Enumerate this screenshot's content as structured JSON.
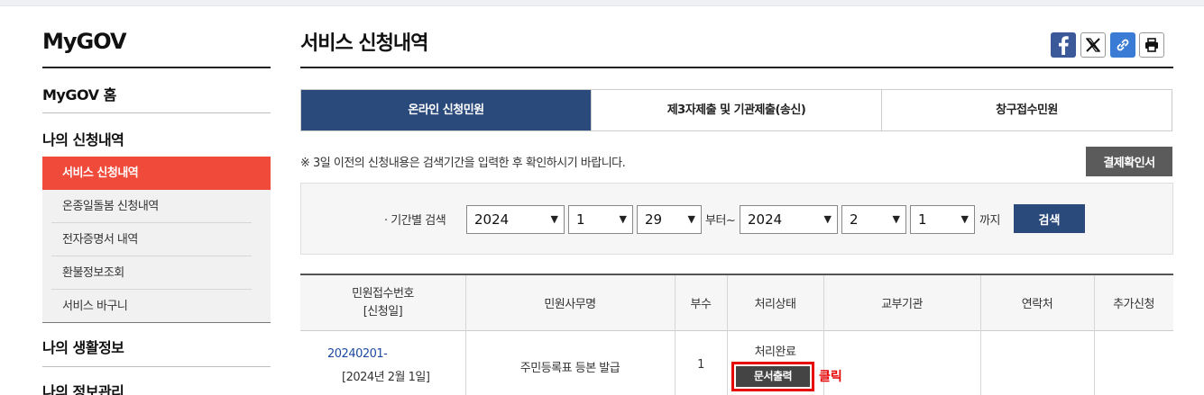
{
  "sidebar": {
    "brand": "MyGOV",
    "home": "MyGOV 홈",
    "section1": "나의 신청내역",
    "items": [
      {
        "label": "서비스 신청내역"
      },
      {
        "label": "온종일돌봄 신청내역"
      },
      {
        "label": "전자증명서 내역"
      },
      {
        "label": "환불정보조회"
      },
      {
        "label": "서비스 바구니"
      }
    ],
    "section2": "나의 생활정보",
    "section3": "나의 정보관리"
  },
  "header": {
    "title": "서비스 신청내역",
    "share_icons": [
      "facebook-icon",
      "x-icon",
      "link-icon",
      "print-icon"
    ]
  },
  "tabs": [
    {
      "label": "온라인 신청민원"
    },
    {
      "label": "제3자제출 및 기관제출(송신)"
    },
    {
      "label": "창구접수민원"
    }
  ],
  "notice": "※ 3일 이전의 신청내용은 검색기간을 입력한 후 확인하시기 바랍니다.",
  "receipt_button": "결제확인서",
  "search": {
    "label": "기간별 검색",
    "from_year": "2024",
    "from_month": "1",
    "from_day": "29",
    "from_word": "부터~",
    "to_year": "2024",
    "to_month": "2",
    "to_day": "1",
    "to_word": "까지",
    "button": "검색"
  },
  "table": {
    "headers": [
      "민원접수번호",
      "[신청일]",
      "민원사무명",
      "부수",
      "처리상태",
      "교부기관",
      "연락처",
      "추가신청"
    ],
    "row": {
      "number": "20240201-",
      "date": "[2024년 2월 1일]",
      "name": "주민등록표 등본 발급",
      "copies": "1",
      "status": "처리완료",
      "print_button": "문서출력",
      "click_note": "클릭"
    }
  },
  "colors": {
    "accent_red": "#f04a3a",
    "navy": "#2a4a7c",
    "highlight_red": "#e60000"
  }
}
